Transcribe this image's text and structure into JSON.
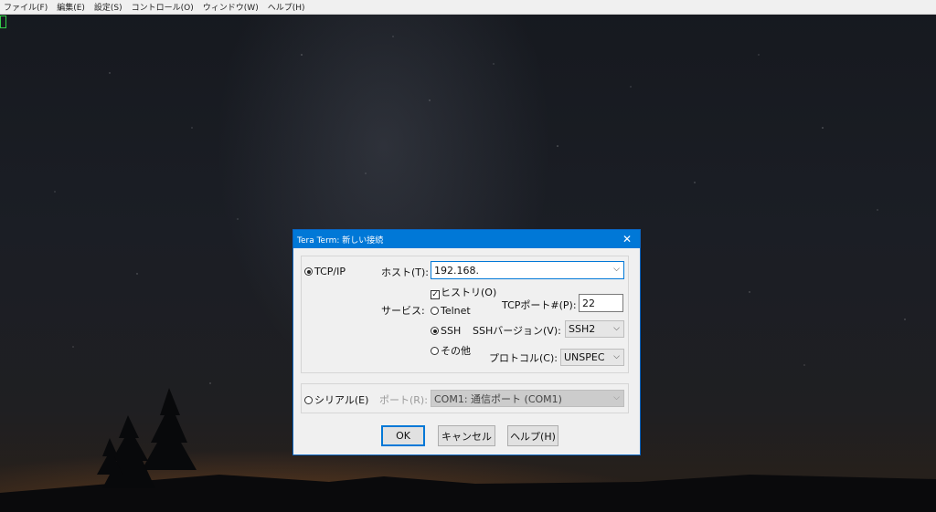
{
  "menubar": {
    "items": [
      "ファイル(F)",
      "編集(E)",
      "設定(S)",
      "コントロール(O)",
      "ウィンドウ(W)",
      "ヘルプ(H)"
    ]
  },
  "dialog": {
    "title": "Tera Term: 新しい接続",
    "close_glyph": "✕",
    "tcpip": {
      "radio_label": "TCP/IP",
      "selected": true,
      "host_label": "ホスト(T):",
      "host_value": "192.168.",
      "history_label": "ヒストリ(O)",
      "history_checked": true,
      "service_label": "サービス:",
      "services": [
        {
          "label": "Telnet",
          "selected": false
        },
        {
          "label": "SSH",
          "selected": true
        },
        {
          "label": "その他",
          "selected": false
        }
      ],
      "tcp_port_label": "TCPポート#(P):",
      "tcp_port_value": "22",
      "ssh_version_label": "SSHバージョン(V):",
      "ssh_version_value": "SSH2",
      "protocol_label": "プロトコル(C):",
      "protocol_value": "UNSPEC"
    },
    "serial": {
      "radio_label": "シリアル(E)",
      "selected": false,
      "port_label": "ポート(R):",
      "port_value": "COM1: 通信ポート (COM1)"
    },
    "buttons": {
      "ok": "OK",
      "cancel": "キャンセル",
      "help": "ヘルプ(H)"
    }
  },
  "icons": {
    "check": "✓",
    "chevron": "⌵"
  },
  "colors": {
    "titlebar": "#0078d7",
    "dialog_bg": "#f0f0f0",
    "cursor": "#34d04a"
  }
}
